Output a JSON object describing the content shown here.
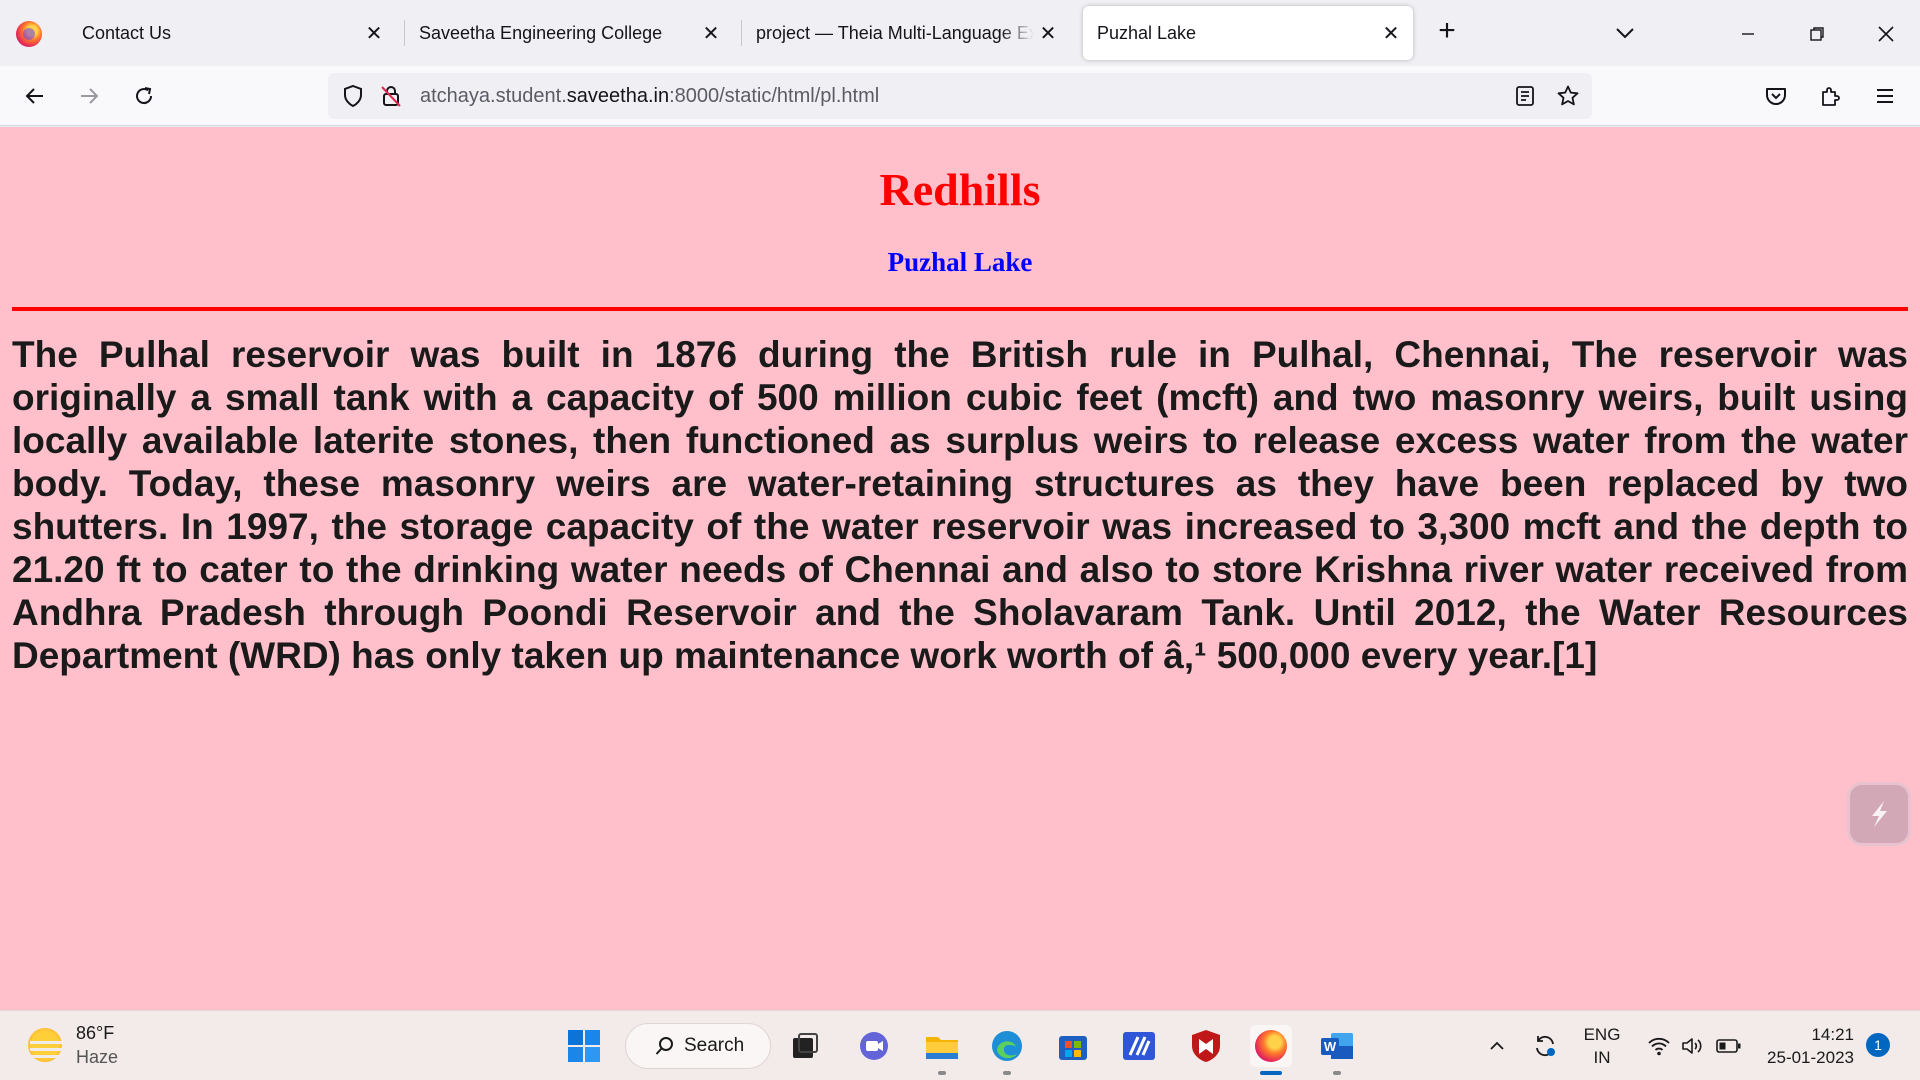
{
  "browser": {
    "tabs": [
      {
        "title": "Contact Us",
        "active": false
      },
      {
        "title": "Saveetha Engineering College",
        "active": false
      },
      {
        "title": "project — Theia Multi-Language Exa",
        "active": false
      },
      {
        "title": "Puzhal Lake",
        "active": true
      }
    ],
    "new_tab_label": "+",
    "url": {
      "prefix": "atchaya.student.",
      "host": "saveetha.in",
      "suffix": ":8000/static/html/pl.html"
    }
  },
  "page": {
    "heading": "Redhills",
    "subheading": "Puzhal Lake",
    "paragraph": "The Pulhal reservoir was built in 1876 during the British rule in Pulhal, Chennai, The reservoir was originally a small tank with a capacity of 500 million cubic feet (mcft) and two masonry weirs, built using locally available laterite stones, then functioned as surplus weirs to release excess water from the water body. Today, these masonry weirs are water-retaining structures as they have been replaced by two shutters. In 1997, the storage capacity of the water reservoir was increased to 3,300 mcft and the depth to 21.20 ft to cater to the drinking water needs of Chennai and also to store Krishna river water received from Andhra Pradesh through Poondi Reservoir and the Sholavaram Tank. Until 2012, the Water Resources Department (WRD) has only taken up maintenance work worth of â‚¹ 500,000 every year.[1]",
    "colors": {
      "background": "#ffc0cb",
      "heading": "#ff0000",
      "subheading": "#0000ff",
      "rule": "#ff0000"
    }
  },
  "taskbar": {
    "weather": {
      "temp": "86°F",
      "condition": "Haze"
    },
    "search_label": "Search",
    "language": {
      "line1": "ENG",
      "line2": "IN"
    },
    "clock": {
      "time": "14:21",
      "date": "25-01-2023"
    },
    "notification_count": "1"
  }
}
